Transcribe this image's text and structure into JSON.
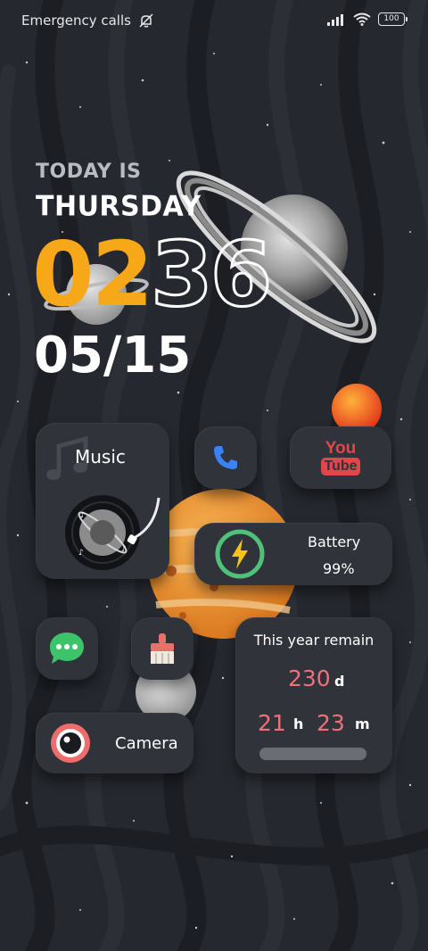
{
  "status_bar": {
    "carrier_text": "Emergency calls",
    "battery_level": "100",
    "icons": [
      "mute-icon",
      "signal-icon",
      "wifi-icon",
      "battery-icon"
    ]
  },
  "clock_widget": {
    "today_label": "TODAY IS",
    "weekday": "THURSDAY",
    "hours": "02",
    "minutes": "36",
    "date": "05/15",
    "hours_color": "#f6a818"
  },
  "music_widget": {
    "label": "Music",
    "icon": "music-note-icon"
  },
  "phone_app": {
    "icon": "phone-icon",
    "color": "#3a82f7"
  },
  "youtube_app": {
    "line1": "You",
    "line2": "Tube",
    "color": "#e0474c"
  },
  "battery_widget": {
    "label": "Battery",
    "value": "99%",
    "accent": "#4fc27a",
    "bolt_color": "#f6c21c"
  },
  "messages_app": {
    "icon": "message-icon",
    "color": "#3dc46b"
  },
  "cleaner_app": {
    "icon": "broom-icon",
    "color": "#e8716b"
  },
  "year_widget": {
    "title": "This year remain",
    "days": "230",
    "days_unit": "d",
    "hours": "21",
    "hours_unit": "h",
    "minutes": "23",
    "minutes_unit": "m",
    "progress_fraction": 1.0,
    "accent": "#f0707a"
  },
  "camera_widget": {
    "label": "Camera",
    "color": "#f06c6c"
  }
}
